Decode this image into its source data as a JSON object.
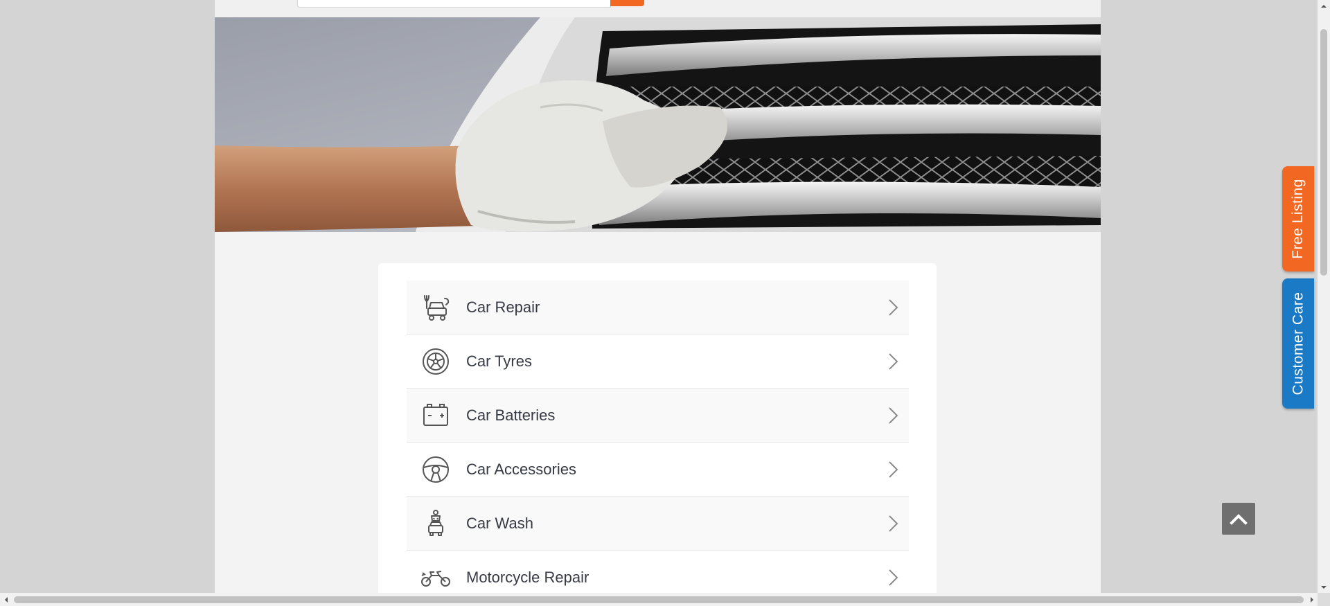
{
  "header": {
    "search_placeholder": ""
  },
  "banner": {
    "image_name": "car-care-banner"
  },
  "categories": {
    "items": [
      {
        "label": "Car Repair",
        "icon": "car-repair-icon"
      },
      {
        "label": "Car Tyres",
        "icon": "tyre-icon"
      },
      {
        "label": "Car Batteries",
        "icon": "battery-icon"
      },
      {
        "label": "Car Accessories",
        "icon": "steering-wheel-icon"
      },
      {
        "label": "Car Wash",
        "icon": "car-wash-icon"
      },
      {
        "label": "Motorcycle Repair",
        "icon": "motorcycle-icon"
      }
    ]
  },
  "side_tabs": {
    "free_listing": "Free Listing",
    "customer_care": "Customer Care"
  },
  "colors": {
    "accent_orange": "#f26722",
    "accent_blue": "#1b7ac6",
    "text_dark": "#363a44"
  }
}
